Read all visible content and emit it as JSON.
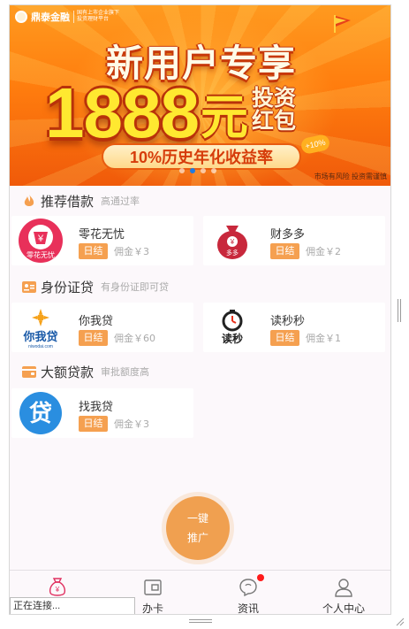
{
  "banner": {
    "brand_name": "鼎泰金融",
    "brand_tagline_1": "国有上市企业旗下",
    "brand_tagline_2": "投资理财平台",
    "headline": "新用户专享",
    "amount": "1888",
    "currency": "元",
    "bonus_line_1": "投资",
    "bonus_line_2": "红包",
    "rate_text": "10%历史年化收益率",
    "rate_badge": "+10%",
    "risk_notice": "市场有风险 投资需谨慎",
    "slide_count": 4,
    "active_slide": 1
  },
  "sections": [
    {
      "title": "推荐借款",
      "subtitle": "高通过率",
      "icon": "flame-icon",
      "items": [
        {
          "name": "零花无忧",
          "tag": "日结",
          "fee": "佣金￥3",
          "logo_text": "零花无忧"
        },
        {
          "name": "财多多",
          "tag": "日结",
          "fee": "佣金￥2",
          "logo_text": "多多"
        }
      ]
    },
    {
      "title": "身份证贷",
      "subtitle": "有身份证即可贷",
      "icon": "id-card-icon",
      "items": [
        {
          "name": "你我贷",
          "tag": "日结",
          "fee": "佣金￥60",
          "logo_text": "你我贷",
          "logo_sub": "niwodai.com"
        },
        {
          "name": "读秒秒",
          "tag": "日结",
          "fee": "佣金￥1",
          "logo_text": "读秒"
        }
      ]
    },
    {
      "title": "大额贷款",
      "subtitle": "审批额度高",
      "icon": "wallet-icon",
      "items": [
        {
          "name": "找我贷",
          "tag": "日结",
          "fee": "佣金￥3",
          "logo_text": "贷"
        }
      ]
    }
  ],
  "promote_button": {
    "line_1": "一键",
    "line_2": "推广"
  },
  "nav": [
    {
      "label": "",
      "icon": "money-bag-icon",
      "active": true
    },
    {
      "label": "办卡",
      "icon": "card-icon",
      "active": false
    },
    {
      "label": "资讯",
      "icon": "chat-bubble-icon",
      "active": false,
      "badge": true
    },
    {
      "label": "个人中心",
      "icon": "user-icon",
      "active": false
    }
  ],
  "status_text": "正在连接...",
  "colors": {
    "tag": "#f5a050",
    "promote": "#f0a050",
    "nav_active": "#e03060",
    "badge": "#ff1a1a",
    "section_icon": "#f5a050"
  }
}
